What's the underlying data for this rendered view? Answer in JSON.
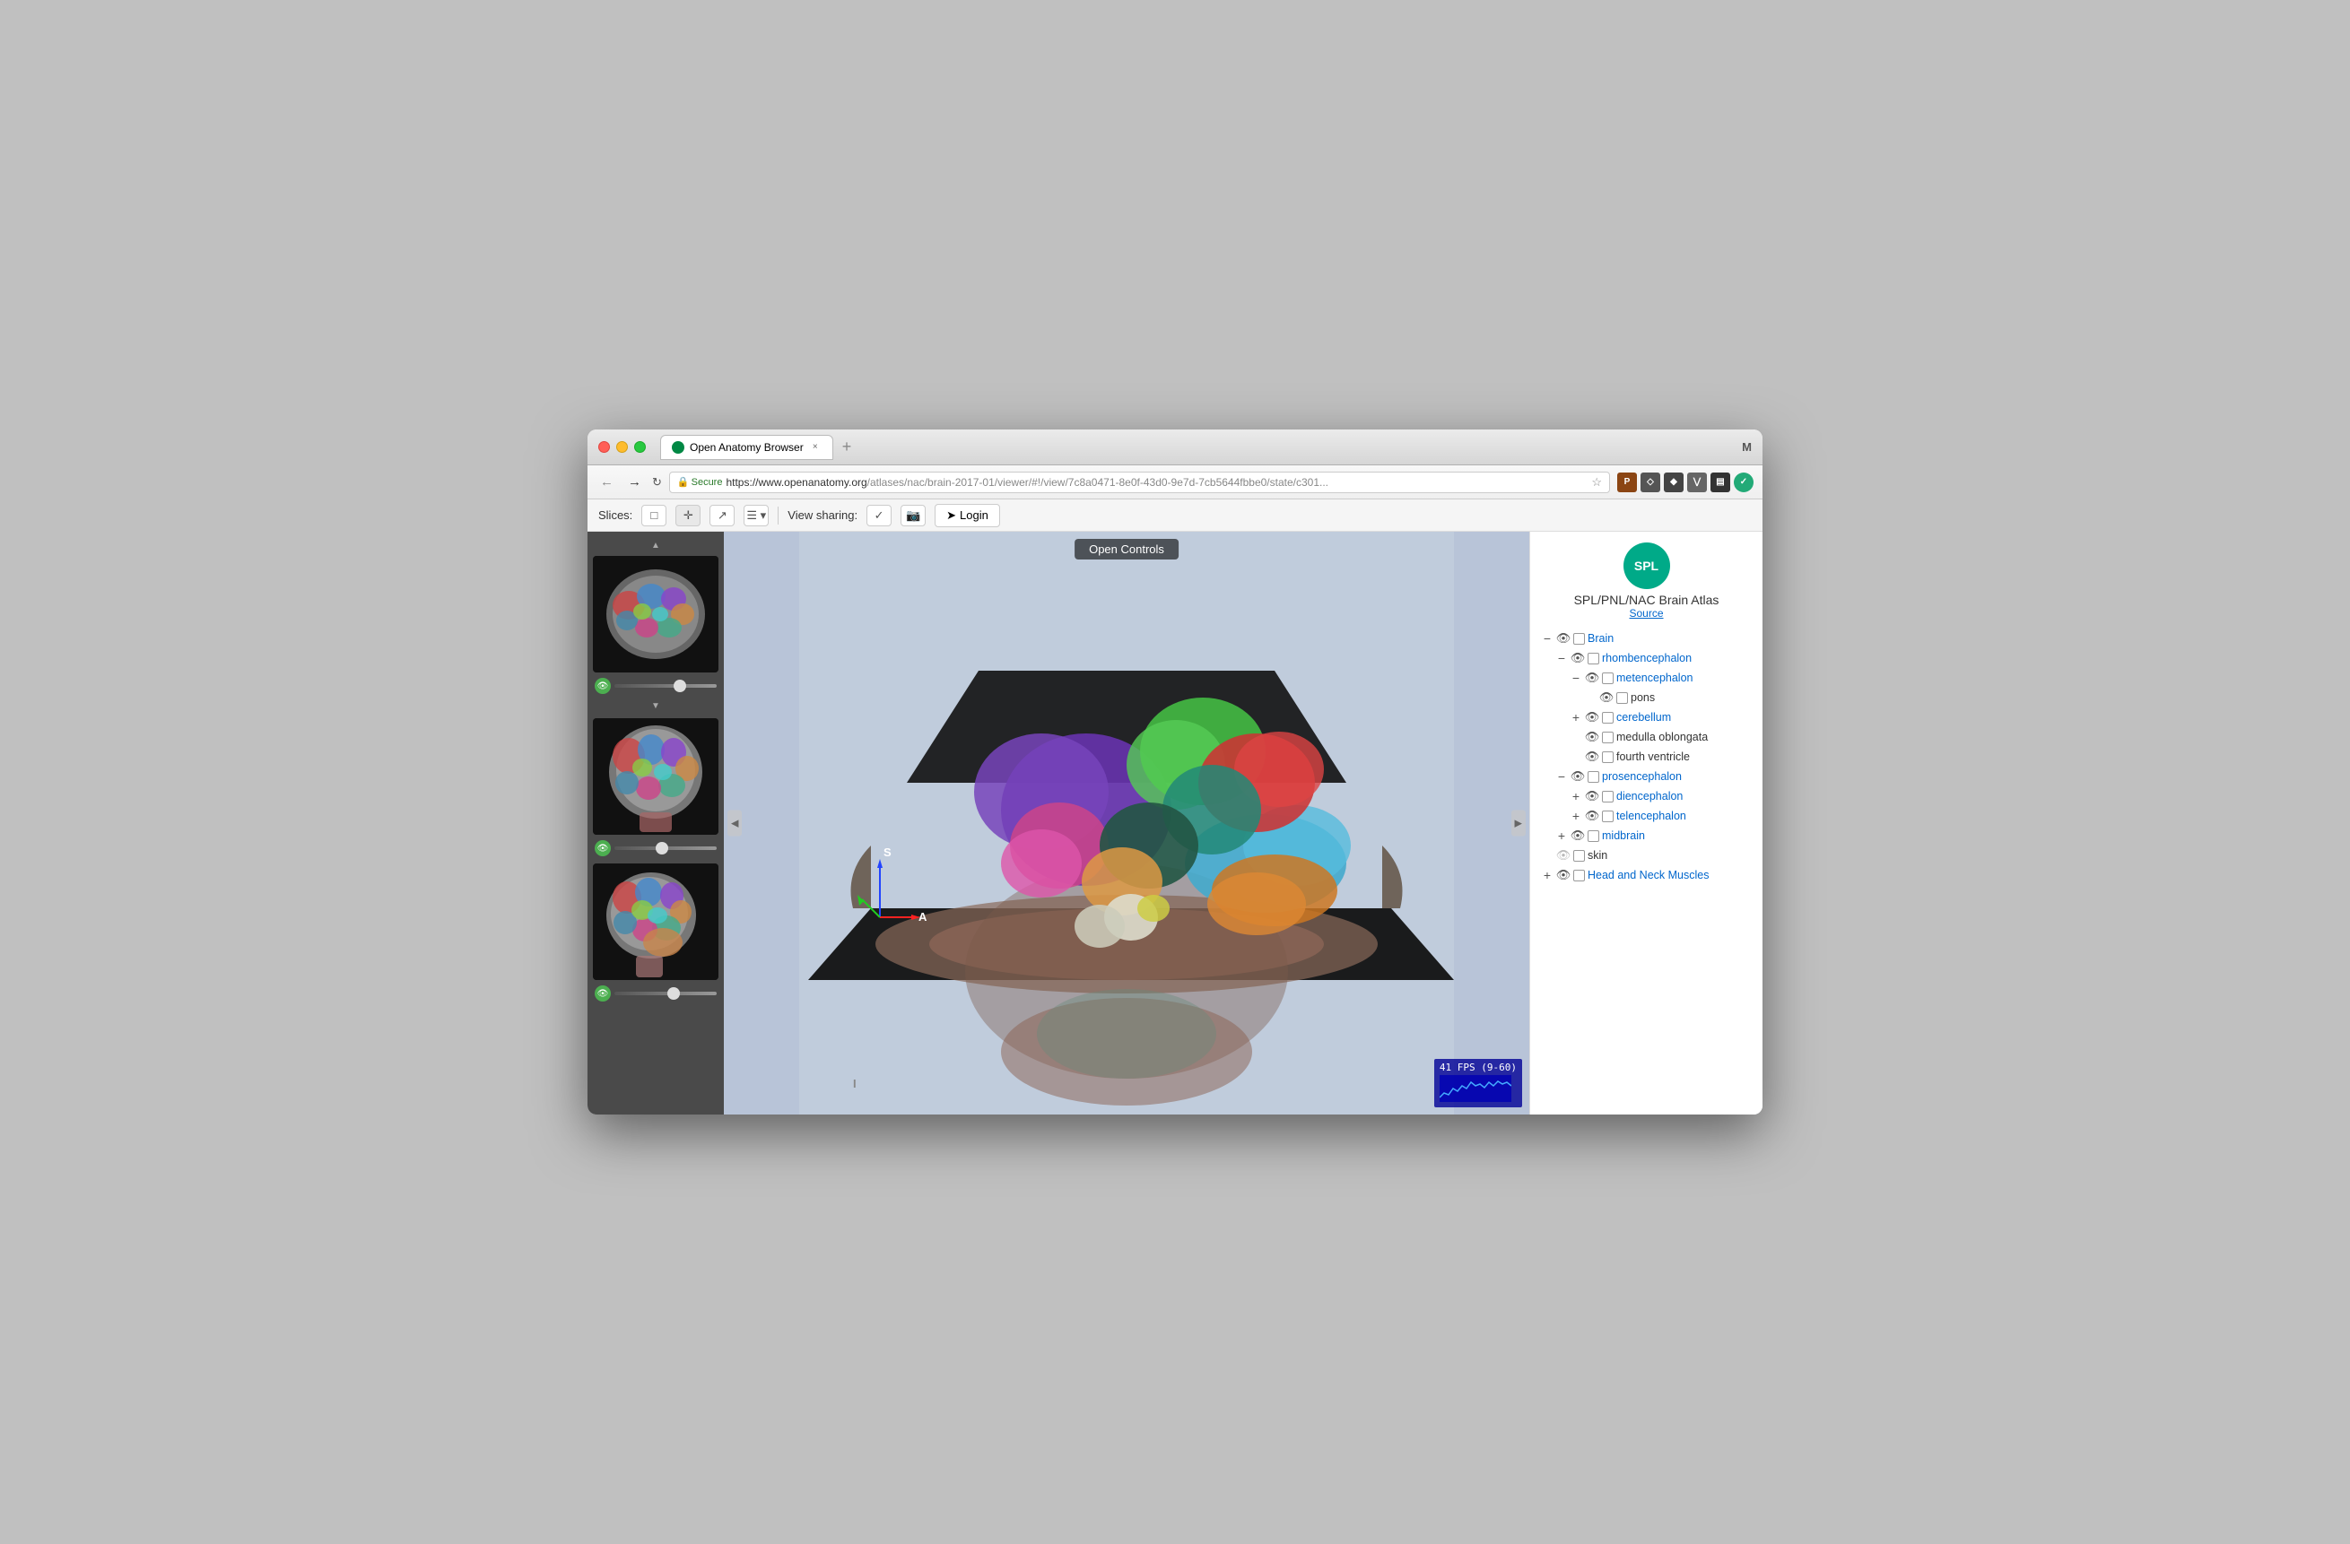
{
  "window": {
    "title": "Open Anatomy Browser",
    "user_initial": "M"
  },
  "tab": {
    "label": "Open Anatomy Browser",
    "close": "×"
  },
  "address_bar": {
    "secure_label": "Secure",
    "url_origin": "https://www.openanatomy.org",
    "url_path": "/atlases/nac/brain-2017-01/viewer/#!/view/7c8a0471-8e0f-43d0-9e7d-7cb5644fbbe0/state/c301..."
  },
  "toolbar": {
    "slices_label": "Slices:",
    "view_sharing_label": "View sharing:",
    "login_label": "Login"
  },
  "viewer": {
    "open_controls_label": "Open Controls",
    "fps_label": "41 FPS (9-60)",
    "axis_s": "S",
    "axis_a": "A",
    "axis_i": "I"
  },
  "atlas": {
    "logo_text": "SPL",
    "title": "SPL/PNL/NAC Brain Atlas",
    "source_label": "Source"
  },
  "structure_tree": [
    {
      "id": "brain",
      "label": "Brain",
      "indent": 0,
      "expand": "minus",
      "eye": true,
      "checkbox": true,
      "link": true
    },
    {
      "id": "rhombencephalon",
      "label": "rhombencephalon",
      "indent": 1,
      "expand": "minus",
      "eye": true,
      "checkbox": true,
      "link": true
    },
    {
      "id": "metencephalon",
      "label": "metencephalon",
      "indent": 2,
      "expand": "minus",
      "eye": true,
      "checkbox": true,
      "link": true
    },
    {
      "id": "pons",
      "label": "pons",
      "indent": 3,
      "expand": null,
      "eye": true,
      "checkbox": true,
      "link": false
    },
    {
      "id": "cerebellum",
      "label": "cerebellum",
      "indent": 2,
      "expand": "plus",
      "eye": true,
      "checkbox": true,
      "link": true
    },
    {
      "id": "medulla",
      "label": "medulla oblongata",
      "indent": 2,
      "expand": null,
      "eye": true,
      "checkbox": true,
      "link": false
    },
    {
      "id": "fourth_ventricle",
      "label": "fourth ventricle",
      "indent": 2,
      "expand": null,
      "eye": true,
      "checkbox": true,
      "link": false
    },
    {
      "id": "prosencephalon",
      "label": "prosencephalon",
      "indent": 1,
      "expand": "minus",
      "eye": true,
      "checkbox": true,
      "link": true
    },
    {
      "id": "diencephalon",
      "label": "diencephalon",
      "indent": 2,
      "expand": "plus",
      "eye": true,
      "checkbox": true,
      "link": true
    },
    {
      "id": "telencephalon",
      "label": "telencephalon",
      "indent": 2,
      "expand": "plus",
      "eye": true,
      "checkbox": true,
      "link": true
    },
    {
      "id": "midbrain",
      "label": "midbrain",
      "indent": 1,
      "expand": "plus",
      "eye": true,
      "checkbox": true,
      "link": true
    },
    {
      "id": "skin",
      "label": "skin",
      "indent": 0,
      "expand": null,
      "eye": true,
      "checkbox": true,
      "link": false
    },
    {
      "id": "head_neck_muscles",
      "label": "Head and Neck Muscles",
      "indent": 0,
      "expand": "plus",
      "eye": true,
      "checkbox": true,
      "link": true
    }
  ]
}
